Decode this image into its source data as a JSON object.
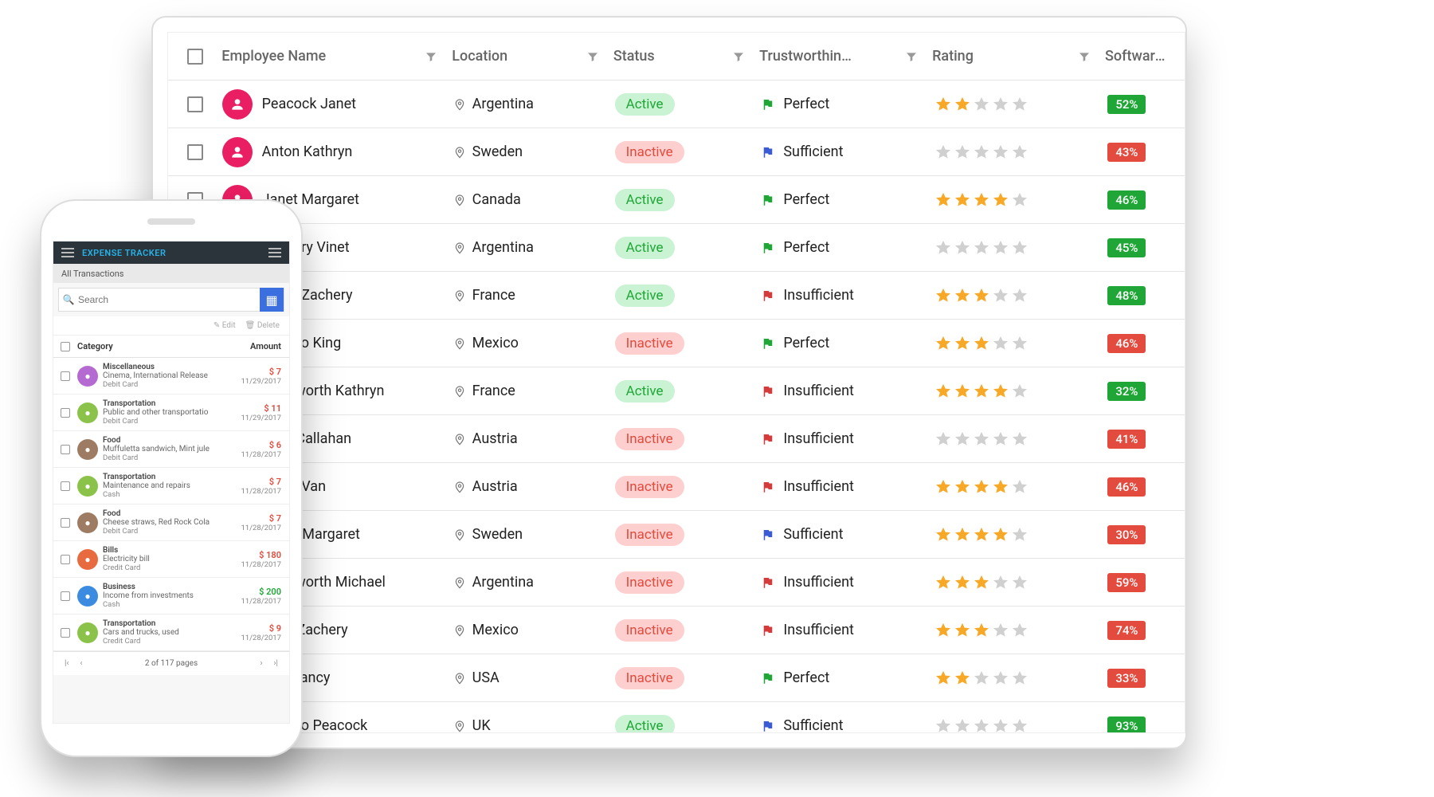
{
  "desktop": {
    "columns": {
      "name": "Employee Name",
      "location": "Location",
      "status": "Status",
      "trust": "Trustworthin…",
      "rating": "Rating",
      "software": "Software P"
    },
    "rows": [
      {
        "name": "Peacock Janet",
        "location": "Argentina",
        "status": "Active",
        "trust": "Perfect",
        "flag": "green",
        "rating": 2,
        "pct": 52,
        "pctColor": "green"
      },
      {
        "name": "Anton Kathryn",
        "location": "Sweden",
        "status": "Inactive",
        "trust": "Sufficient",
        "flag": "blue",
        "rating": 0,
        "pct": 43,
        "pctColor": "red"
      },
      {
        "name": "Janet Margaret",
        "location": "Canada",
        "status": "Active",
        "trust": "Perfect",
        "flag": "green",
        "rating": 4,
        "pct": 46,
        "pctColor": "green"
      },
      {
        "name": "Zachery Vinet",
        "location": "Argentina",
        "status": "Active",
        "trust": "Perfect",
        "flag": "green",
        "rating": 0,
        "pct": 45,
        "pctColor": "green"
      },
      {
        "name": "Janet Zachery",
        "location": "France",
        "status": "Active",
        "trust": "Insufficient",
        "flag": "red",
        "rating": 3,
        "pct": 48,
        "pctColor": "green"
      },
      {
        "name": "Davolio King",
        "location": "Mexico",
        "status": "Inactive",
        "trust": "Perfect",
        "flag": "green",
        "rating": 3,
        "pct": 46,
        "pctColor": "red"
      },
      {
        "name": "Dodsworth Kathryn",
        "location": "France",
        "status": "Active",
        "trust": "Insufficient",
        "flag": "red",
        "rating": 4,
        "pct": 32,
        "pctColor": "green"
      },
      {
        "name": "Jack Callahan",
        "location": "Austria",
        "status": "Inactive",
        "trust": "Insufficient",
        "flag": "red",
        "rating": 0,
        "pct": 41,
        "pctColor": "red"
      },
      {
        "name": "Janet Van",
        "location": "Austria",
        "status": "Inactive",
        "trust": "Insufficient",
        "flag": "red",
        "rating": 4,
        "pct": 46,
        "pctColor": "red"
      },
      {
        "name": "Bergs Margaret",
        "location": "Sweden",
        "status": "Inactive",
        "trust": "Sufficient",
        "flag": "blue",
        "rating": 4,
        "pct": 30,
        "pctColor": "red"
      },
      {
        "name": "Dodsworth Michael",
        "location": "Argentina",
        "status": "Inactive",
        "trust": "Insufficient",
        "flag": "red",
        "rating": 3,
        "pct": 59,
        "pctColor": "red"
      },
      {
        "name": "Fleet Zachery",
        "location": "Mexico",
        "status": "Inactive",
        "trust": "Insufficient",
        "flag": "red",
        "rating": 3,
        "pct": 74,
        "pctColor": "red"
      },
      {
        "name": "Van Nancy",
        "location": "USA",
        "status": "Inactive",
        "trust": "Perfect",
        "flag": "green",
        "rating": 2,
        "pct": 33,
        "pctColor": "red"
      },
      {
        "name": "Davolio Peacock",
        "location": "UK",
        "status": "Active",
        "trust": "Sufficient",
        "flag": "blue",
        "rating": 0,
        "pct": 93,
        "pctColor": "green"
      }
    ]
  },
  "phone": {
    "appTitle": "EXPENSE TRACKER",
    "subheader": "All Transactions",
    "searchPlaceholder": "Search",
    "toolbar": {
      "edit": "Edit",
      "delete": "Delete"
    },
    "columns": {
      "category": "Category",
      "amount": "Amount"
    },
    "rows": [
      {
        "icon": "#b56ad1",
        "category": "Miscellaneous",
        "desc": "Cinema, International Release",
        "method": "Debit Card",
        "amount": "$ 7",
        "amtColor": "#e24b3e",
        "date": "11/29/2017"
      },
      {
        "icon": "#8bc34a",
        "category": "Transportation",
        "desc": "Public and other transportatio",
        "method": "Debit Card",
        "amount": "$ 11",
        "amtColor": "#e24b3e",
        "date": "11/29/2017"
      },
      {
        "icon": "#9e7b63",
        "category": "Food",
        "desc": "Muffuletta sandwich, Mint jule",
        "method": "Debit Card",
        "amount": "$ 6",
        "amtColor": "#e24b3e",
        "date": "11/28/2017"
      },
      {
        "icon": "#8bc34a",
        "category": "Transportation",
        "desc": "Maintenance and repairs",
        "method": "Cash",
        "amount": "$ 7",
        "amtColor": "#e24b3e",
        "date": "11/28/2017"
      },
      {
        "icon": "#9e7b63",
        "category": "Food",
        "desc": "Cheese straws, Red Rock Cola",
        "method": "Debit Card",
        "amount": "$ 7",
        "amtColor": "#e24b3e",
        "date": "11/28/2017"
      },
      {
        "icon": "#e86a3f",
        "category": "Bills",
        "desc": "Electricity bill",
        "method": "Credit Card",
        "amount": "$ 180",
        "amtColor": "#e24b3e",
        "date": "11/28/2017"
      },
      {
        "icon": "#3b8be0",
        "category": "Business",
        "desc": "Income from investments",
        "method": "Cash",
        "amount": "$ 200",
        "amtColor": "#1fa636",
        "date": "11/28/2017"
      },
      {
        "icon": "#8bc34a",
        "category": "Transportation",
        "desc": "Cars and trucks, used",
        "method": "Credit Card",
        "amount": "$ 9",
        "amtColor": "#e24b3e",
        "date": "11/28/2017"
      }
    ],
    "pager": "2 of 117 pages"
  }
}
